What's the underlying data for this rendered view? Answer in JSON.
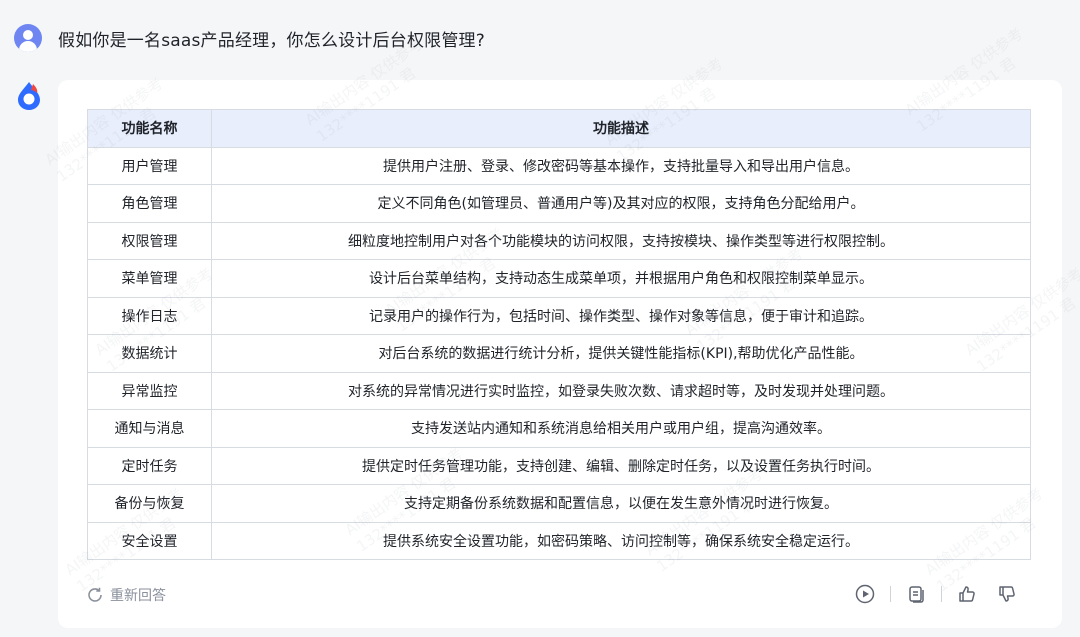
{
  "question": "假如你是一名saas产品经理，你怎么设计后台权限管理?",
  "table": {
    "headers": [
      "功能名称",
      "功能描述"
    ],
    "rows": [
      [
        "用户管理",
        "提供用户注册、登录、修改密码等基本操作，支持批量导入和导出用户信息。"
      ],
      [
        "角色管理",
        "定义不同角色(如管理员、普通用户等)及其对应的权限，支持角色分配给用户。"
      ],
      [
        "权限管理",
        "细粒度地控制用户对各个功能模块的访问权限，支持按模块、操作类型等进行权限控制。"
      ],
      [
        "菜单管理",
        "设计后台菜单结构，支持动态生成菜单项，并根据用户角色和权限控制菜单显示。"
      ],
      [
        "操作日志",
        "记录用户的操作行为，包括时间、操作类型、操作对象等信息，便于审计和追踪。"
      ],
      [
        "数据统计",
        "对后台系统的数据进行统计分析，提供关键性能指标(KPI),帮助优化产品性能。"
      ],
      [
        "异常监控",
        "对系统的异常情况进行实时监控，如登录失败次数、请求超时等，及时发现并处理问题。"
      ],
      [
        "通知与消息",
        "支持发送站内通知和系统消息给相关用户或用户组，提高沟通效率。"
      ],
      [
        "定时任务",
        "提供定时任务管理功能，支持创建、编辑、删除定时任务，以及设置任务执行时间。"
      ],
      [
        "备份与恢复",
        "支持定期备份系统数据和配置信息，以便在发生意外情况时进行恢复。"
      ],
      [
        "安全设置",
        "提供系统安全设置功能，如密码策略、访问控制等，确保系统安全稳定运行。"
      ]
    ]
  },
  "footer": {
    "regenerate_label": "重新回答",
    "icons": [
      "play-icon",
      "copy-icon",
      "thumbs-up-icon",
      "thumbs-down-icon"
    ]
  },
  "watermark": {
    "line1": "AI输出内容 仅供参考",
    "line2": "132****1191 君"
  },
  "colors": {
    "background": "#f5f6f8",
    "card": "#ffffff",
    "table_header": "#e8eefc",
    "border": "#d7dbe2",
    "muted": "#8a909c",
    "avatar": "#6f86f2",
    "logo_blue": "#2f6bff",
    "logo_red": "#f0483e"
  }
}
